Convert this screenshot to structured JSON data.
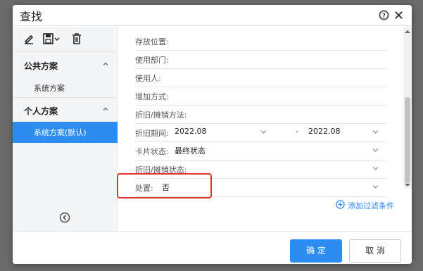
{
  "dialog": {
    "title": "查找"
  },
  "sidebar": {
    "groups": [
      {
        "label": "公共方案",
        "items": [
          "系统方案"
        ]
      },
      {
        "label": "个人方案",
        "items": [
          "系统方案(默认)"
        ]
      }
    ]
  },
  "filters": {
    "rows": [
      {
        "label": "存放位置:",
        "value": ""
      },
      {
        "label": "使用部门:",
        "value": ""
      },
      {
        "label": "使用人:",
        "value": ""
      },
      {
        "label": "增加方式:",
        "value": ""
      },
      {
        "label": "折旧/摊销方法:",
        "value": ""
      },
      {
        "label": "折旧期间:",
        "value_from": "2022.08",
        "range_sep": "-",
        "value_to": "2022.08"
      },
      {
        "label": "卡片状态:",
        "value": "最终状态"
      },
      {
        "label": "折旧/摊销状态:",
        "value": ""
      },
      {
        "label": "处置:",
        "value": "否"
      }
    ],
    "add_filter_label": "添加过滤条件"
  },
  "footer": {
    "ok_label": "确 定",
    "cancel_label": "取 消"
  },
  "colors": {
    "accent": "#2d8cf0",
    "highlight": "#e0352b",
    "sidebar_bg": "#f4f5f7"
  },
  "icons": [
    "edit-icon",
    "save-icon",
    "delete-icon",
    "help-icon",
    "close-icon",
    "collapse-icon",
    "back-icon",
    "add-circle-icon",
    "caret-down-icon"
  ]
}
